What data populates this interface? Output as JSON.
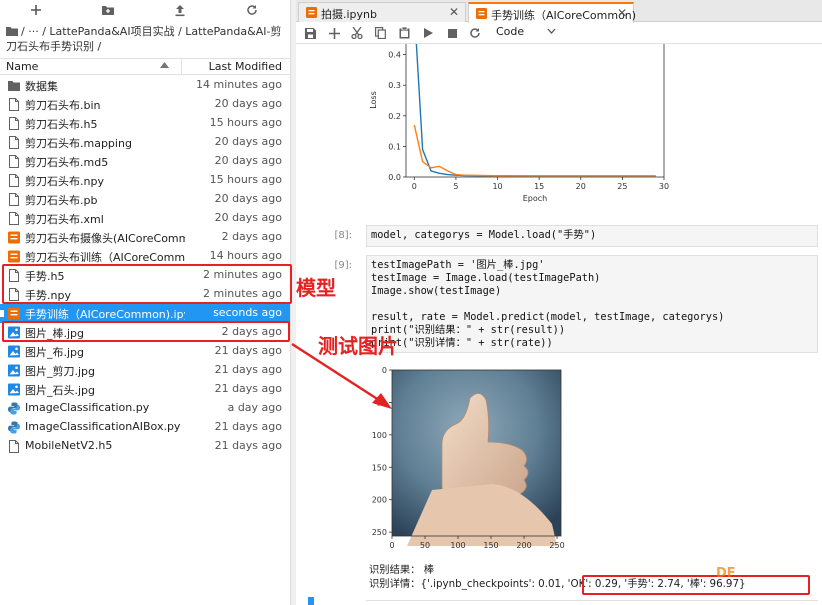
{
  "browser": {
    "breadcrumb": "/ ··· / LattePanda&AI项目实战 / LattePanda&AI-剪刀石头布手势识别 /",
    "col_name": "Name",
    "col_modified": "Last Modified",
    "files": [
      {
        "name": "数据集",
        "modified": "14 minutes ago",
        "kind": "folder"
      },
      {
        "name": "剪刀石头布.bin",
        "modified": "20 days ago",
        "kind": "file"
      },
      {
        "name": "剪刀石头布.h5",
        "modified": "15 hours ago",
        "kind": "file"
      },
      {
        "name": "剪刀石头布.mapping",
        "modified": "20 days ago",
        "kind": "file"
      },
      {
        "name": "剪刀石头布.md5",
        "modified": "20 days ago",
        "kind": "file"
      },
      {
        "name": "剪刀石头布.npy",
        "modified": "15 hours ago",
        "kind": "file"
      },
      {
        "name": "剪刀石头布.pb",
        "modified": "20 days ago",
        "kind": "file"
      },
      {
        "name": "剪刀石头布.xml",
        "modified": "20 days ago",
        "kind": "file"
      },
      {
        "name": "剪刀石头布摄像头(AICoreComm...",
        "modified": "2 days ago",
        "kind": "notebook"
      },
      {
        "name": "剪刀石头布训练（AICoreCommo...",
        "modified": "14 hours ago",
        "kind": "notebook"
      },
      {
        "name": "手势.h5",
        "modified": "2 minutes ago",
        "kind": "file"
      },
      {
        "name": "手势.npy",
        "modified": "2 minutes ago",
        "kind": "file"
      },
      {
        "name": "手势训练（AICoreCommon).ipynb",
        "modified": "seconds ago",
        "kind": "notebook",
        "selected": true
      },
      {
        "name": "图片_棒.jpg",
        "modified": "2 days ago",
        "kind": "image"
      },
      {
        "name": "图片_布.jpg",
        "modified": "21 days ago",
        "kind": "image"
      },
      {
        "name": "图片_剪刀.jpg",
        "modified": "21 days ago",
        "kind": "image"
      },
      {
        "name": "图片_石头.jpg",
        "modified": "21 days ago",
        "kind": "image"
      },
      {
        "name": "ImageClassification.py",
        "modified": "a day ago",
        "kind": "python"
      },
      {
        "name": "ImageClassificationAIBox.py",
        "modified": "21 days ago",
        "kind": "python"
      },
      {
        "name": "MobileNetV2.h5",
        "modified": "21 days ago",
        "kind": "file"
      }
    ]
  },
  "tabs": [
    {
      "label": "拍摄.ipynb",
      "active": false
    },
    {
      "label": "手势训练（AICoreCommon)",
      "active": true
    }
  ],
  "toolbar": {
    "cell_type": "Code"
  },
  "cells": {
    "c8": {
      "prompt": "[8]:",
      "code": "model, categorys = Model.load(\"手势\")"
    },
    "c9": {
      "prompt": "[9]:",
      "lines": [
        "testImagePath = '图片_棒.jpg'",
        "testImage = Image.load(testImagePath)",
        "Image.show(testImage)",
        "",
        "result, rate = Model.predict(model, testImage, categorys)",
        "print(\"识别结果：\" + str(result))",
        "print(\"识别详情：\" + str(rate))"
      ]
    },
    "output": {
      "result_line": "识别结果： 棒",
      "detail_line": "识别详情：{'.ipynb_checkpoints': 0.01, 'OK': 0.29, '手势': 2.74, '棒': 96.97}"
    }
  },
  "annotations": {
    "model_label": "模型",
    "image_label": "测试图片",
    "colors": {
      "red": "#e52222",
      "accent": "#2196f3",
      "tab_accent": "#f57c00"
    }
  },
  "chart_data": [
    {
      "type": "line",
      "xlabel": "Epoch",
      "ylabel": "Loss",
      "xlim": [
        -1,
        30
      ],
      "ylim": [
        0,
        0.5
      ],
      "xticks": [
        0,
        5,
        10,
        15,
        20,
        25,
        30
      ],
      "yticks": [
        0.0,
        0.1,
        0.2,
        0.3,
        0.4
      ],
      "series": [
        {
          "color": "#1f77b4",
          "x": [
            0,
            1,
            2,
            3,
            4,
            5,
            6,
            8,
            10,
            15,
            20,
            25,
            29
          ],
          "y": [
            0.55,
            0.09,
            0.02,
            0.012,
            0.008,
            0.006,
            0.005,
            0.004,
            0.004,
            0.003,
            0.003,
            0.003,
            0.003
          ]
        },
        {
          "color": "#ff7f0e",
          "x": [
            0,
            1,
            2,
            3,
            4,
            5,
            6,
            8,
            10,
            15,
            20,
            25,
            29
          ],
          "y": [
            0.17,
            0.05,
            0.03,
            0.035,
            0.02,
            0.008,
            0.006,
            0.005,
            0.004,
            0.004,
            0.004,
            0.004,
            0.004
          ]
        }
      ]
    },
    {
      "type": "heatmap",
      "xlim": [
        0,
        256
      ],
      "ylim": [
        256,
        0
      ],
      "xticks": [
        0,
        50,
        100,
        150,
        200,
        250
      ],
      "yticks": [
        0,
        50,
        100,
        150,
        200,
        250
      ]
    }
  ]
}
